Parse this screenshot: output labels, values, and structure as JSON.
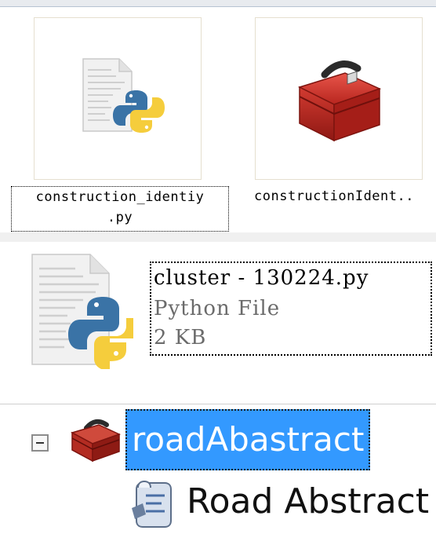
{
  "large_icons": [
    {
      "name": "construction_identiy",
      "name_line1": "construction_identiy",
      "name_line2": ".py",
      "icon": "python-file-icon",
      "selected": true
    },
    {
      "name": "constructionIdent..",
      "icon": "toolbox-icon",
      "selected": false
    }
  ],
  "details_view": {
    "file_name": "cluster - 130224.py",
    "file_type": "Python File",
    "file_size": "2 KB",
    "icon": "python-file-icon"
  },
  "tree": {
    "toolbox_label": "roadAbastract",
    "toolbox_icon": "toolbox-icon",
    "expander_icon": "collapse-minus-icon",
    "child_label": "Road Abstract",
    "child_icon": "script-tool-icon"
  },
  "colors": {
    "selection_blue": "#3399ff",
    "secondary_text": "#6b6b6b",
    "python_blue": "#3a73a6",
    "python_yellow": "#f5cd3c",
    "toolbox_red": "#c8312a"
  }
}
